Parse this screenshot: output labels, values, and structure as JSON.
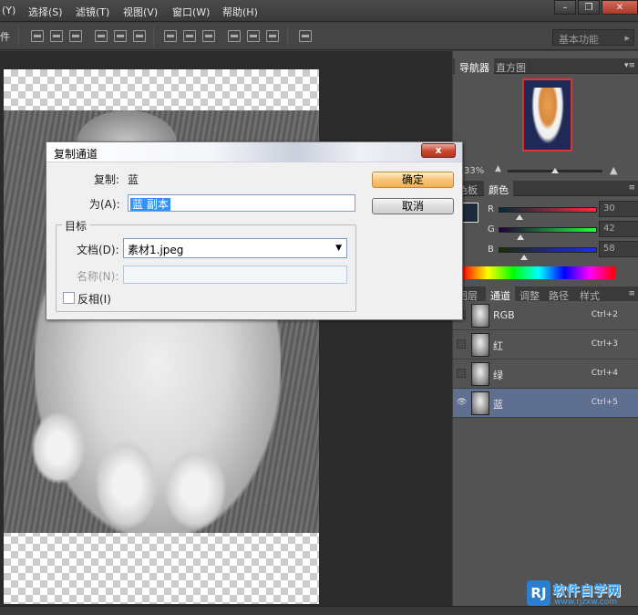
{
  "menubar": {
    "items": [
      "(Y)",
      "选择(S)",
      "滤镜(T)",
      "视图(V)",
      "窗口(W)",
      "帮助(H)"
    ]
  },
  "optionsbar": {
    "left_label": "件",
    "workspace": "基本功能"
  },
  "navigator": {
    "tabs": [
      "导航器",
      "直方图"
    ],
    "zoom": "33%"
  },
  "color_panel": {
    "tabs": [
      "色板",
      "颜色"
    ],
    "fg_color": "#1e2a3a",
    "channels": [
      {
        "label": "R",
        "value": "30"
      },
      {
        "label": "G",
        "value": "42"
      },
      {
        "label": "B",
        "value": "58"
      }
    ]
  },
  "channels_panel": {
    "tabs": [
      "图层",
      "通道",
      "调整",
      "路径",
      "样式"
    ],
    "rows": [
      {
        "name": "RGB",
        "shortcut": "Ctrl+2"
      },
      {
        "name": "红",
        "shortcut": "Ctrl+3"
      },
      {
        "name": "绿",
        "shortcut": "Ctrl+4"
      },
      {
        "name": "蓝",
        "shortcut": "Ctrl+5"
      }
    ]
  },
  "dialog": {
    "title": "复制通道",
    "source_label": "复制:",
    "source_value": "蓝",
    "as_label": "为(A):",
    "as_value": "蓝 副本",
    "group_label": "目标",
    "document_label": "文档(D):",
    "document_value": "素材1.jpeg",
    "name_label": "名称(N):",
    "invert_label": "反相(I)",
    "ok": "确定",
    "cancel": "取消",
    "close": "x"
  },
  "watermark": {
    "logo": "RJ",
    "title": "软件自学网",
    "url": "www.rjzxw.com"
  }
}
